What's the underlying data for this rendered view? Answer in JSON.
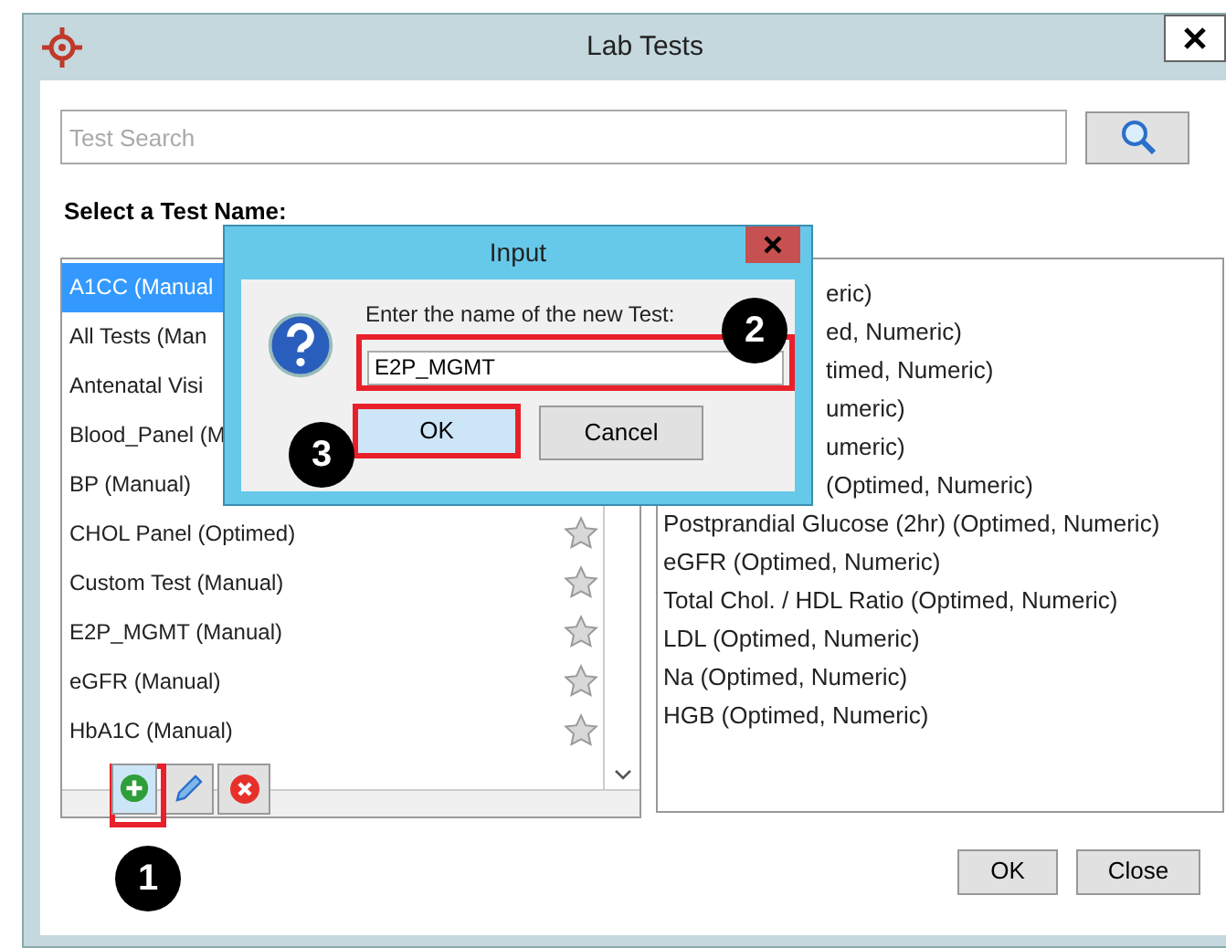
{
  "window": {
    "title": "Lab Tests"
  },
  "search": {
    "placeholder": "Test Search"
  },
  "heading": "Select a Test Name:",
  "tests": [
    {
      "text": "A1CC (Manual",
      "selected": true,
      "star": false
    },
    {
      "text": "All Tests (Man",
      "selected": false,
      "star": false
    },
    {
      "text": "Antenatal Visi",
      "selected": false,
      "star": false
    },
    {
      "text": "Blood_Panel (M",
      "selected": false,
      "star": false
    },
    {
      "text": "BP (Manual)",
      "selected": false,
      "star": false
    },
    {
      "text": "CHOL Panel (Optimed)",
      "selected": false,
      "star": true
    },
    {
      "text": "Custom Test (Manual)",
      "selected": false,
      "star": true
    },
    {
      "text": "E2P_MGMT (Manual)",
      "selected": false,
      "star": true
    },
    {
      "text": "eGFR (Manual)",
      "selected": false,
      "star": true
    },
    {
      "text": "HbA1C (Manual)",
      "selected": false,
      "star": true
    }
  ],
  "components": [
    {
      "text": "eric)",
      "covered": true
    },
    {
      "text": "ed, Numeric)",
      "covered": true
    },
    {
      "text": "timed, Numeric)",
      "covered": true
    },
    {
      "text": "umeric)",
      "covered": true
    },
    {
      "text": "umeric)",
      "covered": true
    },
    {
      "text": "(Optimed, Numeric)",
      "covered": true
    },
    {
      "text": "Postprandial Glucose (2hr) (Optimed, Numeric)",
      "covered": false
    },
    {
      "text": "eGFR (Optimed, Numeric)",
      "covered": false
    },
    {
      "text": "Total Chol. / HDL Ratio (Optimed, Numeric)",
      "covered": false
    },
    {
      "text": "LDL (Optimed, Numeric)",
      "covered": false
    },
    {
      "text": "Na (Optimed, Numeric)",
      "covered": false
    },
    {
      "text": "HGB (Optimed, Numeric)",
      "covered": false
    }
  ],
  "buttons": [
    "OK",
    "Close"
  ],
  "dialog": {
    "title": "Input",
    "prompt": "Enter the name of the new Test:",
    "value": "E2P_MGMT",
    "buttons": [
      "OK",
      "Cancel"
    ]
  },
  "steps": [
    "1",
    "2",
    "3"
  ]
}
